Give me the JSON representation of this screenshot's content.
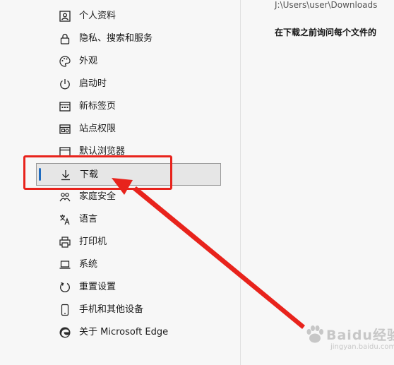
{
  "sidebar": {
    "items": [
      {
        "label": "个人资料",
        "icon": "profile-icon"
      },
      {
        "label": "隐私、搜索和服务",
        "icon": "lock-icon"
      },
      {
        "label": "外观",
        "icon": "palette-icon"
      },
      {
        "label": "启动时",
        "icon": "power-icon"
      },
      {
        "label": "新标签页",
        "icon": "new-tab-icon"
      },
      {
        "label": "站点权限",
        "icon": "site-permissions-icon"
      },
      {
        "label": "默认浏览器",
        "icon": "browser-icon"
      },
      {
        "label": "下载",
        "icon": "download-icon",
        "active": true
      },
      {
        "label": "家庭安全",
        "icon": "family-icon"
      },
      {
        "label": "语言",
        "icon": "language-icon"
      },
      {
        "label": "打印机",
        "icon": "printer-icon"
      },
      {
        "label": "系统",
        "icon": "laptop-icon"
      },
      {
        "label": "重置设置",
        "icon": "reset-icon"
      },
      {
        "label": "手机和其他设备",
        "icon": "phone-icon"
      },
      {
        "label": "关于 Microsoft Edge",
        "icon": "edge-logo-icon"
      }
    ]
  },
  "content": {
    "download_path": "J:\\Users\\user\\Downloads",
    "ask_setting": "在下载之前询问每个文件的"
  },
  "annotation": {
    "color": "#e8231c"
  },
  "watermark": {
    "text": "Baidu经验",
    "sub": "jingyan.baidu.com"
  },
  "colors": {
    "accent": "#1f6bbf",
    "background": "#f7f7f7"
  }
}
